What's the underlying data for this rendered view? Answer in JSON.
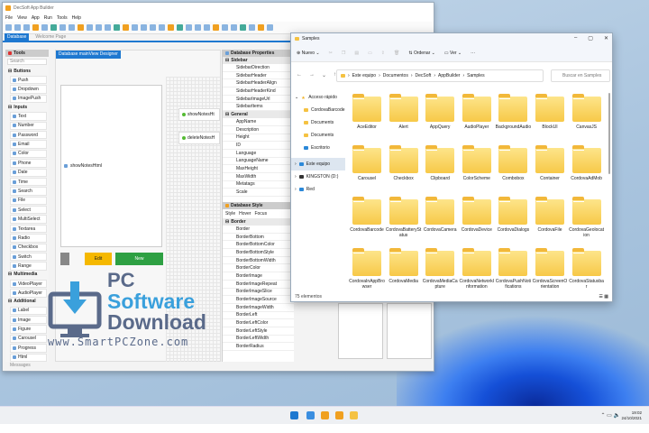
{
  "app": {
    "title": "DecSoft App Builder",
    "menu": [
      "File",
      "View",
      "App",
      "Run",
      "Tools",
      "Help"
    ],
    "doc_tabs": [
      "Database",
      "Welcome Page"
    ],
    "messages": "Messages"
  },
  "tools": {
    "title": "Tools",
    "search_placeholder": "Search",
    "groups": [
      {
        "label": "Buttons",
        "items": [
          "Push",
          "Dropdown",
          "ImagePush"
        ]
      },
      {
        "label": "Inputs",
        "items": [
          "Text",
          "Number",
          "Password",
          "Email",
          "Color",
          "Phone",
          "Date",
          "Time",
          "Search",
          "File",
          "Select",
          "MultiSelect",
          "Textarea",
          "Radio",
          "Checkbox",
          "Switch",
          "Range"
        ]
      },
      {
        "label": "Multimedia",
        "items": [
          "VideoPlayer",
          "AudioPlayer"
        ]
      },
      {
        "label": "Additional",
        "items": [
          "Label",
          "Image",
          "Figure",
          "Carousel",
          "Progress",
          "Html"
        ]
      }
    ]
  },
  "designer": {
    "tab": "Database mainView Designer",
    "canvas_item": "showNotesHtml",
    "right_items": [
      "showNotesHt",
      "deleteNotesH"
    ],
    "edit_button": "Edit",
    "new_button": "New"
  },
  "properties": {
    "title": "Database Properties",
    "groups": [
      {
        "label": "Sidebar",
        "items": [
          "SidebarDirection",
          "SidebarHeader",
          "SidebarHeaderAlign",
          "SidebarHeaderKind",
          "SidebarImageUrl",
          "SidebarItems"
        ]
      },
      {
        "label": "General",
        "items": [
          "AppName",
          "Description",
          "Height",
          "ID",
          "Language",
          "LanguageName",
          "MaxHeight",
          "MaxWidth",
          "Metatags",
          "Scale"
        ]
      }
    ]
  },
  "style": {
    "title": "Database Style",
    "tabs": [
      "Style",
      "Hover",
      "Focus"
    ],
    "group": "Border",
    "items": [
      "Border",
      "BorderBottom",
      "BorderBottomColor",
      "BorderBottomStyle",
      "BorderBottomWidth",
      "BorderColor",
      "BorderImage",
      "BorderImageRepeat",
      "BorderImageSlice",
      "BorderImageSource",
      "BorderImageWidth",
      "BorderLeft",
      "BorderLeftColor",
      "BorderLeftStyle",
      "BorderLeftWidth",
      "BorderRadius"
    ]
  },
  "explorer": {
    "title": "Samples",
    "new": "Nuevo",
    "sort": "Ordenar",
    "view": "Ver",
    "more": "···",
    "breadcrumb": [
      "Este equipo",
      "Documentos",
      "DecSoft",
      "AppBuilder",
      "Samples"
    ],
    "search_placeholder": "Buscar en Samples",
    "nav": [
      {
        "label": "Acceso rápido",
        "level": 0
      },
      {
        "label": "CordovaBarcode",
        "level": 1
      },
      {
        "label": "Documents",
        "level": 1
      },
      {
        "label": "Documents",
        "level": 1
      },
      {
        "label": "Escritorio",
        "level": 1
      },
      {
        "label": "Este equipo",
        "level": 0,
        "selected": true
      },
      {
        "label": "KINGSTON (D:)",
        "level": 0
      },
      {
        "label": "Red",
        "level": 0
      }
    ],
    "folders": [
      "AceEditor",
      "Alert",
      "AppQuery",
      "AudioPlayer",
      "BackgroundAudio",
      "BlockUI",
      "CanvasJS",
      "Carousel",
      "Checkbox",
      "Clipboard",
      "ColorScheme",
      "Combobox",
      "Container",
      "CordovaAdMob",
      "CordovaBarcode",
      "CordovaBatteryStatus",
      "CordovaCamera",
      "CordovaDevice",
      "CordovaDialogs",
      "CordovaFile",
      "CordovaGeolocation",
      "CordovaInAppBrowser",
      "CordovaMedia",
      "CordovaMediaCapture",
      "CordovaNetworkInformation",
      "CordovaPushNotifications",
      "CordovaScreenOrientation",
      "CordovaStatusbar"
    ],
    "status": "75 elementos"
  },
  "watermark": {
    "line1": "PC",
    "line2": "Software",
    "line3": "Download",
    "url": "www.SmartPCZone.com"
  },
  "taskbar": {
    "time": "19:02",
    "date": "24/10/2021",
    "icons": [
      "start-icon",
      "search-icon",
      "app-builder-icon",
      "app-builder-icon-2",
      "file-explorer-icon"
    ]
  },
  "colors": {
    "accent": "#1e78d0",
    "edit": "#f5b800",
    "new": "#2ea043",
    "folder": "#f7c948"
  }
}
